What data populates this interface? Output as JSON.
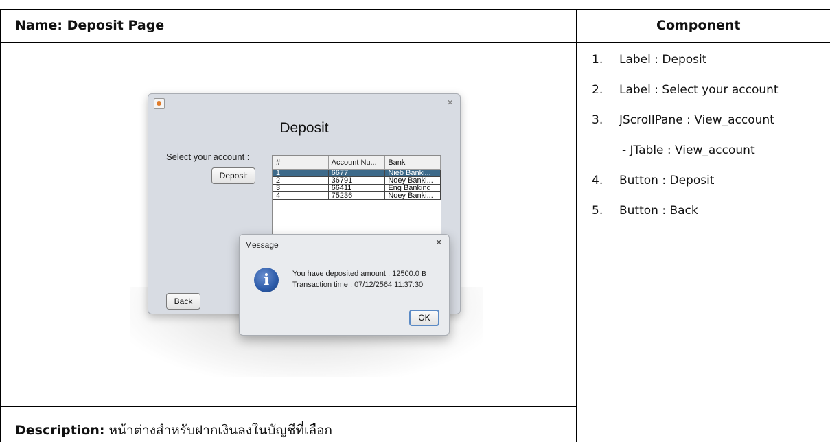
{
  "document": {
    "name_label": "Name:",
    "name_value": "Deposit Page",
    "component_header": "Component",
    "description_label": "Description:",
    "description_value": "หน้าต่างสำหรับฝากเงินลงในบัญชีที่เลือก"
  },
  "components": [
    {
      "num": "1.",
      "text": "Label : Deposit"
    },
    {
      "num": "2.",
      "text": "Label : Select your account"
    },
    {
      "num": "3.",
      "text": "JScrollPane : View_account"
    },
    {
      "num": "",
      "text": "- JTable : View_account"
    },
    {
      "num": "4.",
      "text": "Button : Deposit"
    },
    {
      "num": "5.",
      "text": "Button : Back"
    }
  ],
  "window": {
    "close_glyph": "×",
    "title": "Deposit",
    "select_label": "Select your account :",
    "deposit_button": "Deposit",
    "back_button": "Back",
    "table": {
      "headers": [
        "#",
        "Account Nu...",
        "Bank"
      ],
      "rows": [
        [
          "1",
          "6677",
          "Nieb Banki..."
        ],
        [
          "2",
          "36791",
          "Noey Banki..."
        ],
        [
          "3",
          "66411",
          "Eng Banking"
        ],
        [
          "4",
          "75236",
          "Noey Banki..."
        ]
      ],
      "selected_row": 0
    }
  },
  "dialog": {
    "title": "Message",
    "close_glyph": "×",
    "icon_letter": "i",
    "line1": "You have deposited amount : 12500.0 ฿",
    "line2": "Transaction time : 07/12/2564 11:37:30",
    "ok_button": "OK"
  }
}
